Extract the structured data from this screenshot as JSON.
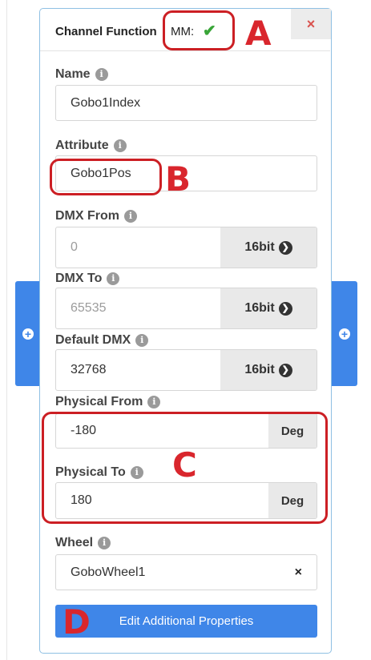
{
  "header": {
    "title": "Channel Function",
    "mm_label": "MM:",
    "close": "×"
  },
  "fields": {
    "name": {
      "label": "Name",
      "value": "Gobo1Index"
    },
    "attribute": {
      "label": "Attribute",
      "value": "Gobo1Pos"
    },
    "dmx_from": {
      "label": "DMX From",
      "placeholder": "0",
      "unit": "16bit"
    },
    "dmx_to": {
      "label": "DMX To",
      "placeholder": "65535",
      "unit": "16bit"
    },
    "default_dmx": {
      "label": "Default DMX",
      "value": "32768",
      "unit": "16bit"
    },
    "physical_from": {
      "label": "Physical From",
      "value": "-180",
      "unit": "Deg"
    },
    "physical_to": {
      "label": "Physical To",
      "value": "180",
      "unit": "Deg"
    },
    "wheel": {
      "label": "Wheel",
      "value": "GoboWheel1",
      "clear": "×"
    }
  },
  "edit_button": "Edit Additional Properties",
  "annotations": {
    "a": "A",
    "b": "B",
    "c": "C",
    "d": "D",
    "color": "#cc1f24"
  },
  "icons": {
    "info": "i",
    "arrow": "❯",
    "check": "✔",
    "add": "+"
  },
  "colors": {
    "accent": "#3f86e8",
    "check": "#39a538"
  }
}
